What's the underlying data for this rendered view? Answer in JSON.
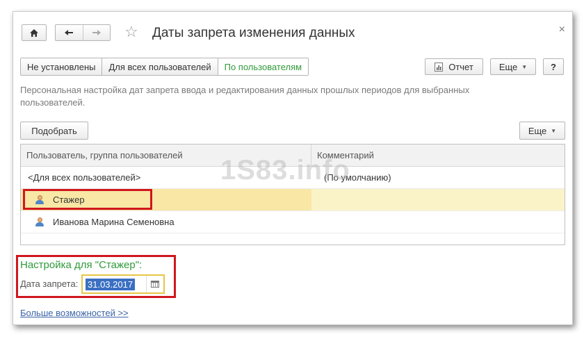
{
  "window": {
    "title": "Даты запрета изменения данных",
    "close": "×"
  },
  "tabs": [
    {
      "label": "Не установлены",
      "active": false
    },
    {
      "label": "Для всех пользователей",
      "active": false
    },
    {
      "label": "По пользователям",
      "active": true
    }
  ],
  "toolbar": {
    "report_label": "Отчет",
    "more_label": "Еще",
    "help_label": "?"
  },
  "description": "Персональная настройка дат запрета ввода и редактирования данных прошлых периодов для выбранных пользователей.",
  "list_toolbar": {
    "pick_label": "Подобрать",
    "more_label": "Еще"
  },
  "table": {
    "columns": [
      "Пользователь, группа пользователей",
      "Комментарий"
    ],
    "rows": [
      {
        "user": "<Для всех пользователей>",
        "comment": "(По умолчанию)",
        "icon": "",
        "selected": false
      },
      {
        "user": "Стажер",
        "comment": "",
        "icon": "user-icon",
        "selected": true
      },
      {
        "user": "Иванова Марина Семеновна",
        "comment": "",
        "icon": "user-icon",
        "selected": false
      }
    ]
  },
  "watermark": "1S83.info",
  "settings": {
    "title": "Настройка для \"Стажер\":",
    "date_label": "Дата запрета:",
    "date_value": "31.03.2017"
  },
  "more_link": "Больше возможностей >>",
  "colors": {
    "accent_green": "#2f9a3a",
    "highlight_red": "#d0161d",
    "selected_row": "#fbf3c8",
    "link_blue": "#3a64a8"
  }
}
